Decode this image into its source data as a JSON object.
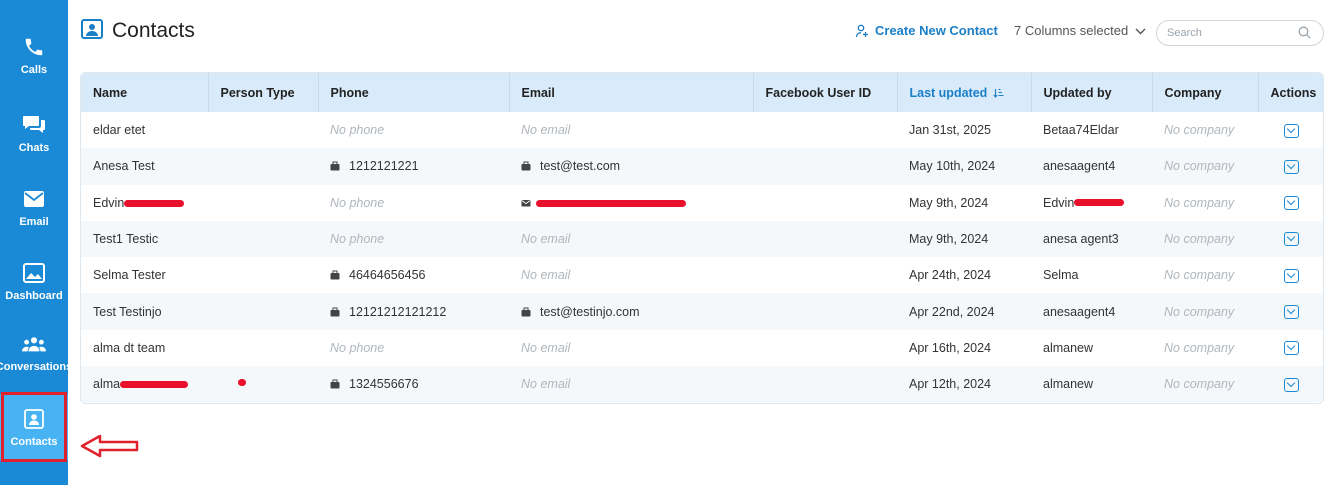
{
  "sidebar": {
    "items": [
      {
        "label": "Calls",
        "icon": "phone-icon"
      },
      {
        "label": "Chats",
        "icon": "chat-icon"
      },
      {
        "label": "Email",
        "icon": "envelope-icon"
      },
      {
        "label": "Dashboard",
        "icon": "image-icon"
      },
      {
        "label": "Conversations",
        "icon": "group-icon"
      },
      {
        "label": "Contacts",
        "icon": "contact-card-icon",
        "active": true
      }
    ],
    "accent": "#1b8ad6",
    "active_bg": "#47b3f2"
  },
  "header": {
    "title": "Contacts",
    "create_label": "Create New Contact",
    "columns_label": "7 Columns selected",
    "search_placeholder": "Search"
  },
  "table": {
    "columns": [
      "Name",
      "Person Type",
      "Phone",
      "Email",
      "Facebook User ID",
      "Last updated",
      "Updated by",
      "Company",
      "Actions"
    ],
    "sorted_column": "Last updated",
    "rows": [
      {
        "name": "eldar etet",
        "person_type": "",
        "phone": "No phone",
        "email": "No email",
        "facebook": "",
        "updated": "Jan 31st, 2025",
        "updated_by": "Betaa74Eldar",
        "company": "No company"
      },
      {
        "name": "Anesa Test",
        "person_type": "",
        "phone": "1212121221",
        "email": "test@test.com",
        "facebook": "",
        "updated": "May 10th, 2024",
        "updated_by": "anesaagent4",
        "company": "No company"
      },
      {
        "name": "Edvin",
        "person_type": "",
        "phone": "No phone",
        "email": "",
        "facebook": "",
        "updated": "May 9th, 2024",
        "updated_by": "Edvin",
        "company": "No company"
      },
      {
        "name": "Test1 Testic",
        "person_type": "",
        "phone": "No phone",
        "email": "No email",
        "facebook": "",
        "updated": "May 9th, 2024",
        "updated_by": "anesa agent3",
        "company": "No company"
      },
      {
        "name": "Selma Tester",
        "person_type": "",
        "phone": "46464656456",
        "email": "No email",
        "facebook": "",
        "updated": "Apr 24th, 2024",
        "updated_by": "Selma",
        "company": "No company"
      },
      {
        "name": "Test Testinjo",
        "person_type": "",
        "phone": "12121212121212",
        "email": "test@testinjo.com",
        "facebook": "",
        "updated": "Apr 22nd, 2024",
        "updated_by": "anesaagent4",
        "company": "No company"
      },
      {
        "name": "alma dt team",
        "person_type": "",
        "phone": "No phone",
        "email": "No email",
        "facebook": "",
        "updated": "Apr 16th, 2024",
        "updated_by": "almanew",
        "company": "No company"
      },
      {
        "name": "alma",
        "person_type": "",
        "phone": "1324556676",
        "email": "No email",
        "facebook": "",
        "updated": "Apr 12th, 2024",
        "updated_by": "almanew",
        "company": "No company"
      }
    ]
  },
  "colors": {
    "header_bg": "#d9ebfb",
    "link": "#1b7fc7",
    "annotation_red": "#e0202a"
  }
}
